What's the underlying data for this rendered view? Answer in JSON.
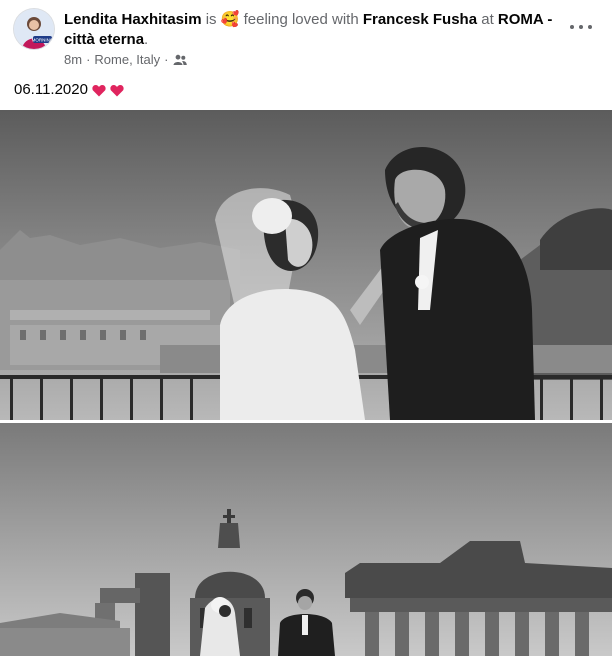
{
  "post": {
    "author": "Lendita Haxhitasim",
    "verb_is": "is",
    "feeling_emoji": "🥰",
    "feeling_text": "feeling loved with",
    "tagged": "Francesk Fusha",
    "at_text": "at",
    "place": "ROMA - città eterna",
    "period": ".",
    "time": "8m",
    "location": "Rome, Italy",
    "audience_icon": "friends-icon",
    "caption": "06.11.2020"
  },
  "avatar": {
    "badge_text": "MORNING"
  },
  "colors": {
    "text_primary": "#050505",
    "text_secondary": "#65676b",
    "heart": "#e0245e"
  }
}
